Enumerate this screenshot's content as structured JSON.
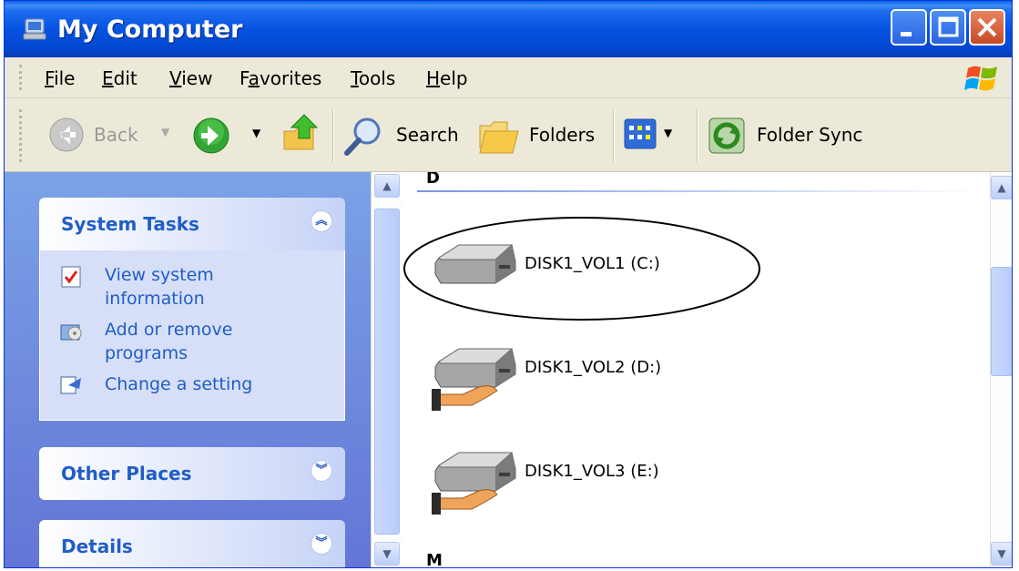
{
  "window": {
    "title": "My Computer"
  },
  "menu": {
    "items": [
      {
        "pre": "",
        "u": "F",
        "post": "ile"
      },
      {
        "pre": "",
        "u": "E",
        "post": "dit"
      },
      {
        "pre": "",
        "u": "V",
        "post": "iew"
      },
      {
        "pre": "F",
        "u": "a",
        "post": "vorites"
      },
      {
        "pre": "",
        "u": "T",
        "post": "ools"
      },
      {
        "pre": "",
        "u": "H",
        "post": "elp"
      }
    ]
  },
  "toolbar": {
    "back": "Back",
    "search": "Search",
    "folders": "Folders",
    "folder_sync": "Folder Sync"
  },
  "left_pane": {
    "system_tasks": {
      "title": "System Tasks",
      "tasks": [
        {
          "line1": "View system",
          "line2": "information"
        },
        {
          "line1": "Add or remove",
          "line2": "programs"
        },
        {
          "line1": "Change a setting",
          "line2": ""
        }
      ]
    },
    "other_places": {
      "title": "Other Places"
    },
    "details": {
      "title": "Details"
    }
  },
  "content": {
    "group_top": "D",
    "group_bottom": "M",
    "drives": [
      {
        "label": "DISK1_VOL1 (C:)"
      },
      {
        "label": "DISK1_VOL2 (D:)"
      },
      {
        "label": "DISK1_VOL3 (E:)"
      }
    ]
  },
  "colors": {
    "titlebar": "#0553e1",
    "task_link": "#215dc6",
    "left_pane": "#6f8fdf"
  }
}
